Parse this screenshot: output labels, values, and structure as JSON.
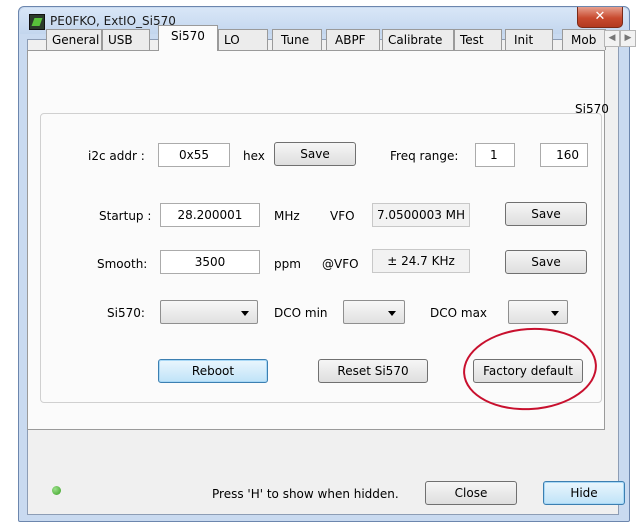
{
  "window": {
    "title": "PE0FKO, ExtIO_Si570",
    "close_glyph": "✕"
  },
  "tabs": [
    {
      "label": "General"
    },
    {
      "label": "USB"
    },
    {
      "label": "Si570"
    },
    {
      "label": "LO"
    },
    {
      "label": "Tune"
    },
    {
      "label": "ABPF"
    },
    {
      "label": "Calibrate"
    },
    {
      "label": "Test"
    },
    {
      "label": "Init"
    },
    {
      "label": "Mob"
    }
  ],
  "active_tab": "Si570",
  "tab_scroll": {
    "left": "◀",
    "right": "▶"
  },
  "group_box_title": "Si570",
  "row1": {
    "i2c_label": "i2c addr :",
    "i2c_value": "0x55",
    "hex_label": "hex",
    "save": "Save",
    "freq_label": "Freq range:",
    "freq_min": "1",
    "freq_max": "160"
  },
  "row2": {
    "startup_label": "Startup :",
    "startup_value": "28.200001",
    "unit": "MHz",
    "vfo_label": "VFO",
    "vfo_value": "7.0500003 MH",
    "save": "Save"
  },
  "row3": {
    "smooth_label": "Smooth:",
    "smooth_value": "3500",
    "unit": "ppm",
    "vfo_label": "@VFO",
    "vfo_value": "± 24.7 KHz",
    "save": "Save"
  },
  "row4": {
    "si570_label": "Si570:",
    "dco_min_label": "DCO min",
    "dco_max_label": "DCO max"
  },
  "actions": {
    "reboot": "Reboot",
    "reset": "Reset Si570",
    "factory": "Factory default"
  },
  "footer": {
    "hint": "Press 'H' to show when hidden.",
    "close": "Close",
    "hide": "Hide"
  },
  "colors": {
    "annotation_circle": "#c8102e",
    "status_led": "#3aa024"
  }
}
